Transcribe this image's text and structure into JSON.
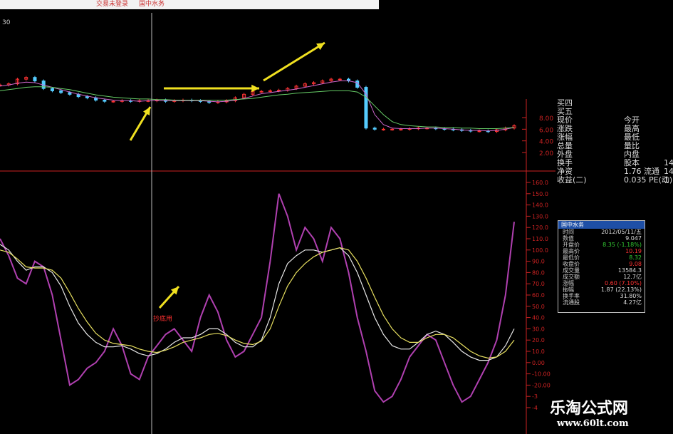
{
  "topbar": {
    "login_text": "交易未登录",
    "stock_name": "国中水务"
  },
  "price_panel": {
    "period_label": "30",
    "price_ticks": [
      "8.00",
      "6.00",
      "4.00",
      "2.00"
    ]
  },
  "quote_panel": {
    "rows": [
      {
        "label": "买四",
        "mid": "",
        "right": ""
      },
      {
        "label": "买五",
        "mid": "",
        "right": ""
      },
      {
        "label": "现价",
        "mid": "今开",
        "right": ""
      },
      {
        "label": "涨跌",
        "mid": "最高",
        "right": ""
      },
      {
        "label": "涨幅",
        "mid": "最低",
        "right": ""
      },
      {
        "label": "总量",
        "mid": "量比",
        "right": ""
      },
      {
        "label": "外盘",
        "mid": "内盘",
        "right": ""
      },
      {
        "label": "换手",
        "mid": "股本",
        "right": "14"
      },
      {
        "label": "净资",
        "mid": "1.76  流通",
        "right": "14"
      },
      {
        "label": "收益(二)",
        "mid": "0.035  PE(动)",
        "right": "1"
      }
    ]
  },
  "info_box": {
    "title": "国中水务",
    "rows": [
      {
        "key": "时间",
        "value": "2012/05/11/五",
        "color": "#dddddd"
      },
      {
        "key": "数值",
        "value": "9.047",
        "color": "#dddddd"
      },
      {
        "key": "开盘价",
        "value": "8.35 (-1.18%)",
        "color": "#33cc33"
      },
      {
        "key": "最高价",
        "value": "10.19",
        "color": "#ff3333"
      },
      {
        "key": "最低价",
        "value": "8.32",
        "color": "#33cc33"
      },
      {
        "key": "收盘价",
        "value": "9.08",
        "color": "#ff3333"
      },
      {
        "key": "成交量",
        "value": "13584.3",
        "color": "#dddddd"
      },
      {
        "key": "成交额",
        "value": "12.7亿",
        "color": "#dddddd"
      },
      {
        "key": "涨幅",
        "value": "0.60 (7.10%)",
        "color": "#ff3333"
      },
      {
        "key": "振幅",
        "value": "1.87 (22.13%)",
        "color": "#dddddd"
      },
      {
        "key": "换手率",
        "value": "31.80%",
        "color": "#dddddd"
      },
      {
        "key": "流通股",
        "value": "4.27亿",
        "color": "#dddddd"
      }
    ]
  },
  "annotation": {
    "signal_label": "抄底用"
  },
  "watermark": {
    "line1": "乐淘公式网",
    "line2": "www.60lt.com"
  },
  "colors": {
    "background": "#000000",
    "axis": "#cc2222",
    "up_candle": "#ff3333",
    "down_candle": "#55ccff",
    "ma_purple": "#cc66cc",
    "ma_green": "#66cc66",
    "osc_magenta": "#b040b0",
    "osc_white": "#e8e8e8",
    "osc_yellow": "#e8e060",
    "arrow": "#f0e020"
  },
  "chart_data": [
    {
      "type": "line",
      "title": "",
      "ylim": [
        1.5,
        9.0
      ],
      "y_ticks": [
        2.0,
        4.0,
        6.0,
        8.0
      ],
      "x": [
        0,
        1,
        2,
        3,
        4,
        5,
        6,
        7,
        8,
        9,
        10,
        11,
        12,
        13,
        14,
        15,
        16,
        17,
        18,
        19,
        20,
        21,
        22,
        23,
        24,
        25,
        26,
        27,
        28,
        29,
        30,
        31,
        32,
        33,
        34,
        35,
        36,
        37,
        38,
        39,
        40,
        41,
        42,
        43,
        44,
        45,
        46,
        47,
        48,
        49,
        50,
        51,
        52,
        53,
        54,
        55,
        56,
        57,
        58,
        59
      ],
      "series": [
        {
          "kind": "price",
          "values": [
            13.6,
            13.8,
            14.6,
            14.9,
            14.3,
            13.0,
            12.6,
            12.3,
            12.0,
            11.6,
            11.4,
            11.0,
            10.8,
            10.8,
            10.9,
            10.8,
            10.9,
            10.9,
            11.0,
            10.8,
            10.9,
            11.0,
            10.9,
            10.8,
            10.6,
            10.7,
            10.9,
            11.4,
            12.0,
            12.5,
            12.5,
            12.6,
            12.7,
            13.0,
            13.4,
            13.8,
            14.0,
            14.3,
            14.6,
            14.6,
            14.3,
            13.2,
            6.2,
            6.0,
            6.0,
            6.0,
            6.0,
            6.1,
            6.2,
            6.2,
            6.1,
            6.0,
            5.9,
            5.8,
            5.7,
            5.7,
            5.6,
            5.9,
            6.2,
            6.6
          ]
        },
        {
          "kind": "ma",
          "name": "",
          "values": [
            13.4,
            13.6,
            13.9,
            14.1,
            14.0,
            13.6,
            13.2,
            12.8,
            12.4,
            12.0,
            11.7,
            11.4,
            11.2,
            11.0,
            10.9,
            10.9,
            10.8,
            10.9,
            10.9,
            10.9,
            10.9,
            10.9,
            10.9,
            10.9,
            10.8,
            10.7,
            10.8,
            11.0,
            11.3,
            11.7,
            12.1,
            12.3,
            12.5,
            12.7,
            12.9,
            13.2,
            13.5,
            13.8,
            14.1,
            14.3,
            14.3,
            14.0,
            12.0,
            8.5,
            6.8,
            6.2,
            6.1,
            6.1,
            6.1,
            6.2,
            6.2,
            6.1,
            6.0,
            5.9,
            5.8,
            5.8,
            5.7,
            5.8,
            6.0,
            6.3
          ]
        },
        {
          "kind": "ma_long",
          "name": "",
          "values": [
            12.6,
            12.8,
            13.0,
            13.2,
            13.3,
            13.3,
            13.2,
            13.0,
            12.8,
            12.5,
            12.2,
            11.9,
            11.7,
            11.5,
            11.4,
            11.3,
            11.2,
            11.2,
            11.1,
            11.1,
            11.0,
            11.0,
            11.0,
            11.0,
            11.0,
            11.0,
            11.0,
            11.1,
            11.2,
            11.3,
            11.5,
            11.7,
            11.9,
            12.0,
            12.2,
            12.3,
            12.4,
            12.5,
            12.6,
            12.6,
            12.6,
            12.4,
            11.5,
            10.0,
            8.5,
            7.3,
            6.8,
            6.6,
            6.5,
            6.4,
            6.4,
            6.3,
            6.3,
            6.2,
            6.2,
            6.1,
            6.1,
            6.1,
            6.2,
            6.3
          ]
        }
      ]
    },
    {
      "type": "line",
      "title": "",
      "ylim": [
        -40,
        170
      ],
      "y_ticks": [
        160,
        150,
        140,
        130,
        120,
        110,
        100,
        90,
        80,
        70,
        60,
        50,
        40,
        30,
        20,
        10,
        0,
        -10,
        -20,
        -30,
        -40
      ],
      "y_tick_labels": [
        "160.0",
        "150.0",
        "140.0",
        "130.0",
        "120.0",
        "110.0",
        "100.0",
        "90.0",
        "80.0",
        "70.0",
        "60.0",
        "50.0",
        "40.0",
        "30.0",
        "20.0",
        "10.0",
        "0.00",
        "-10.00",
        "-20.00",
        "-3",
        "-4"
      ],
      "x": [
        0,
        1,
        2,
        3,
        4,
        5,
        6,
        7,
        8,
        9,
        10,
        11,
        12,
        13,
        14,
        15,
        16,
        17,
        18,
        19,
        20,
        21,
        22,
        23,
        24,
        25,
        26,
        27,
        28,
        29,
        30,
        31,
        32,
        33,
        34,
        35,
        36,
        37,
        38,
        39,
        40,
        41,
        42,
        43,
        44,
        45,
        46,
        47,
        48,
        49,
        50,
        51,
        52,
        53,
        54,
        55,
        56,
        57,
        58,
        59
      ],
      "series": [
        {
          "kind": "fast",
          "values": [
            110,
            95,
            75,
            70,
            90,
            85,
            60,
            20,
            -20,
            -15,
            -5,
            0,
            10,
            30,
            15,
            -10,
            -15,
            5,
            15,
            25,
            30,
            20,
            10,
            40,
            60,
            45,
            20,
            5,
            10,
            25,
            40,
            90,
            150,
            130,
            100,
            120,
            110,
            90,
            120,
            110,
            80,
            40,
            10,
            -25,
            -35,
            -30,
            -15,
            5,
            15,
            25,
            20,
            0,
            -20,
            -35,
            -30,
            -15,
            0,
            20,
            60,
            125
          ]
        },
        {
          "kind": "mid",
          "values": [
            105,
            100,
            90,
            82,
            85,
            85,
            80,
            68,
            50,
            35,
            25,
            18,
            14,
            14,
            15,
            12,
            8,
            6,
            8,
            12,
            18,
            22,
            22,
            25,
            30,
            30,
            25,
            18,
            14,
            14,
            20,
            40,
            70,
            88,
            95,
            100,
            100,
            98,
            100,
            102,
            95,
            80,
            60,
            40,
            25,
            15,
            12,
            12,
            18,
            25,
            28,
            25,
            18,
            10,
            5,
            2,
            2,
            5,
            15,
            30
          ]
        },
        {
          "kind": "slow",
          "values": [
            100,
            98,
            92,
            85,
            84,
            84,
            82,
            75,
            62,
            48,
            36,
            26,
            20,
            17,
            16,
            15,
            12,
            10,
            9,
            11,
            14,
            18,
            20,
            22,
            25,
            26,
            24,
            20,
            17,
            16,
            19,
            30,
            50,
            68,
            80,
            88,
            94,
            98,
            100,
            102,
            100,
            90,
            75,
            58,
            42,
            30,
            22,
            18,
            18,
            22,
            25,
            25,
            22,
            16,
            10,
            6,
            4,
            5,
            10,
            20
          ]
        }
      ]
    }
  ]
}
